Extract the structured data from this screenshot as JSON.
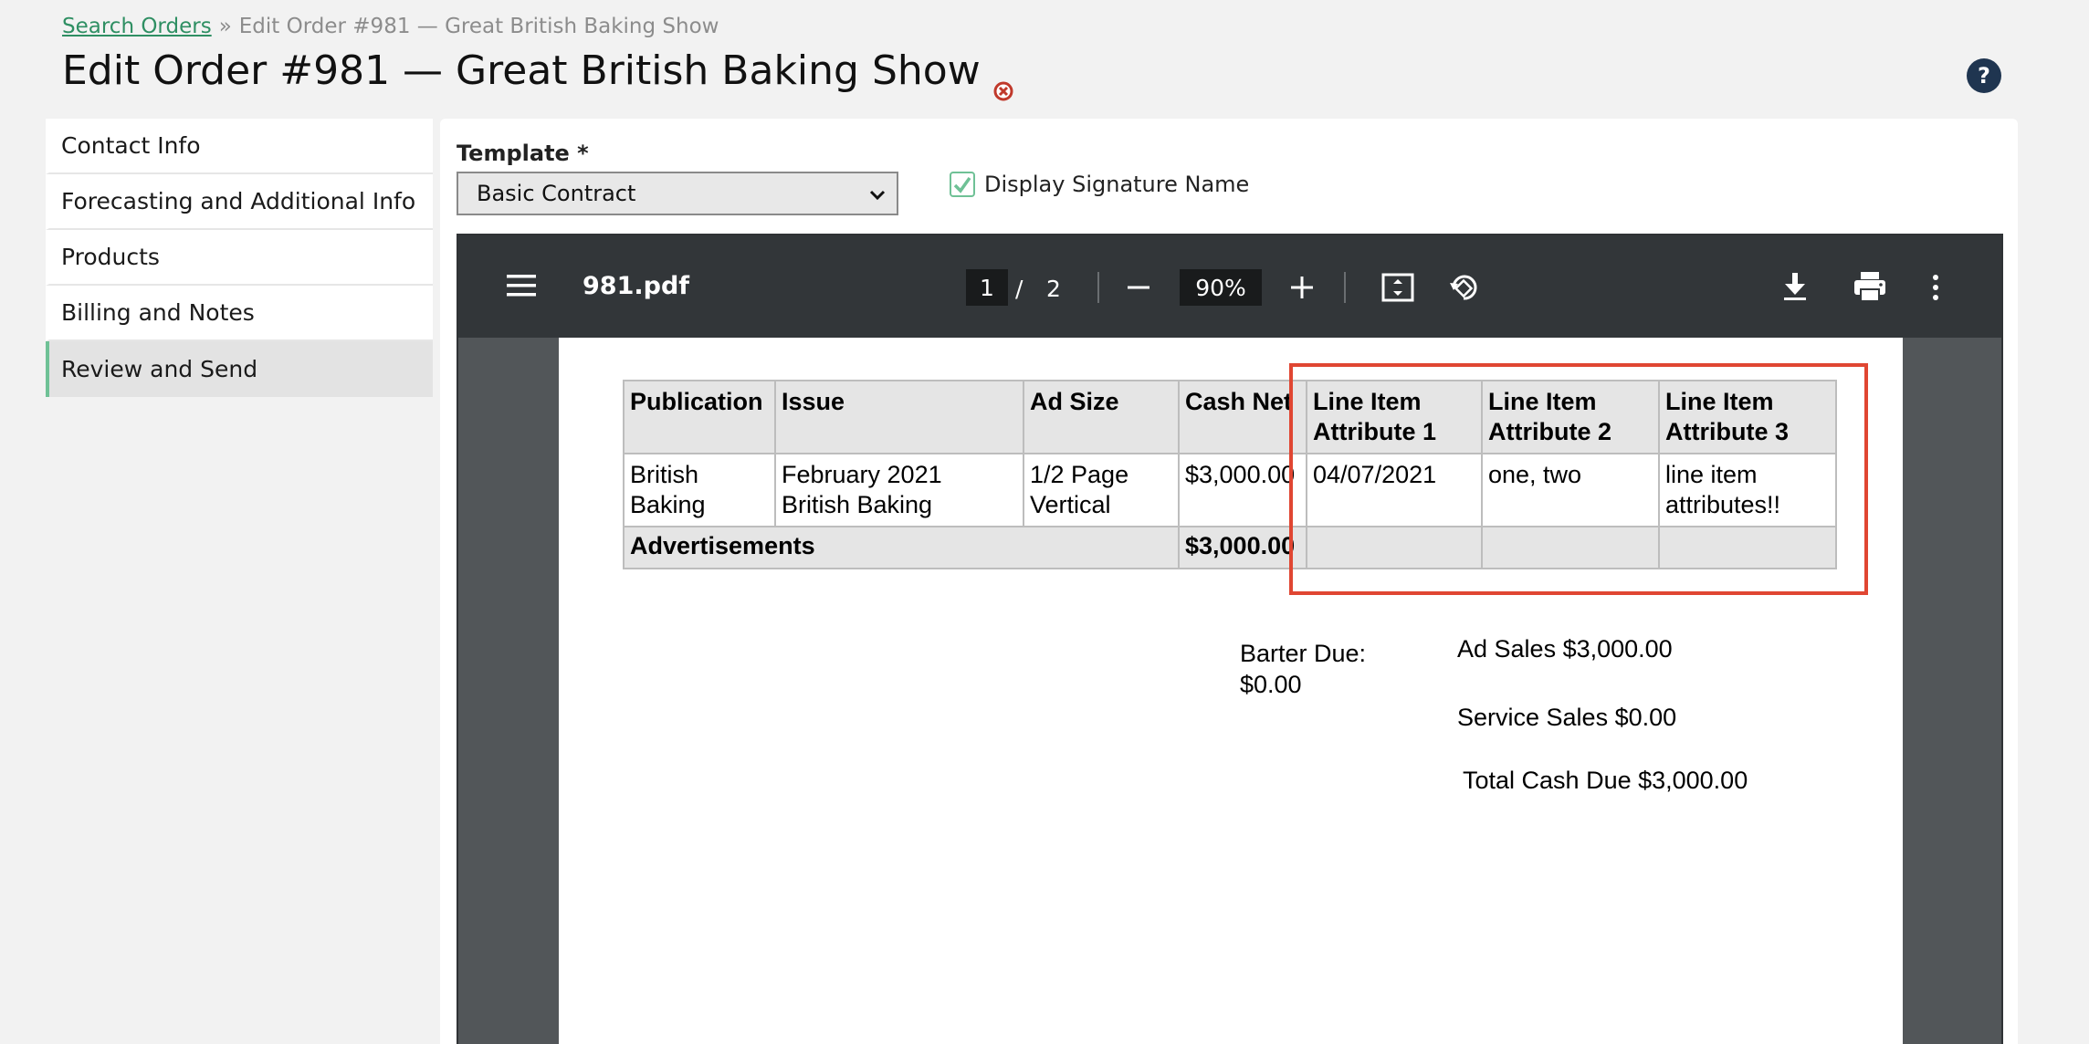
{
  "breadcrumb": {
    "link": "Search Orders",
    "separator": "»",
    "current": "Edit Order #981 — Great British Baking Show"
  },
  "page": {
    "title": "Edit Order #981 — Great British Baking Show",
    "help_label": "?"
  },
  "sidebar": {
    "items": [
      {
        "label": "Contact Info"
      },
      {
        "label": "Forecasting and Additional Info"
      },
      {
        "label": "Products"
      },
      {
        "label": "Billing and Notes"
      },
      {
        "label": "Review and Send",
        "active": true
      }
    ]
  },
  "form": {
    "template_label": "Template *",
    "template_value": "Basic Contract",
    "signature_label": "Display Signature Name",
    "signature_checked": true
  },
  "viewer": {
    "filename": "981.pdf",
    "current_page": "1",
    "page_separator": "/",
    "total_pages": "2",
    "zoom": "90%"
  },
  "pdf": {
    "headers": [
      "Publication",
      "Issue",
      "Ad Size",
      "Cash Net",
      "Line Item Attribute 1",
      "Line Item Attribute 2",
      "Line Item Attribute 3"
    ],
    "row": {
      "publication": "British Baking",
      "issue": "February 2021 British Baking",
      "ad_size": "1/2 Page Vertical",
      "cash_net": "$3,000.00",
      "attr1": "04/07/2021",
      "attr2": "one, two",
      "attr3": "line item attributes!!"
    },
    "total_row": {
      "label": "Advertisements",
      "cash_net": "$3,000.00"
    },
    "summary": {
      "barter_due_label": "Barter Due:",
      "barter_due_value": "$0.00",
      "ad_sales": "Ad Sales $3,000.00",
      "service_sales": "Service Sales $0.00",
      "total_cash_due": "Total Cash Due $3,000.00"
    }
  },
  "colors": {
    "accent_green": "#6fc196",
    "link_green": "#2f8f63",
    "highlight_red": "#e04632",
    "toolbar_dark": "#323639"
  }
}
